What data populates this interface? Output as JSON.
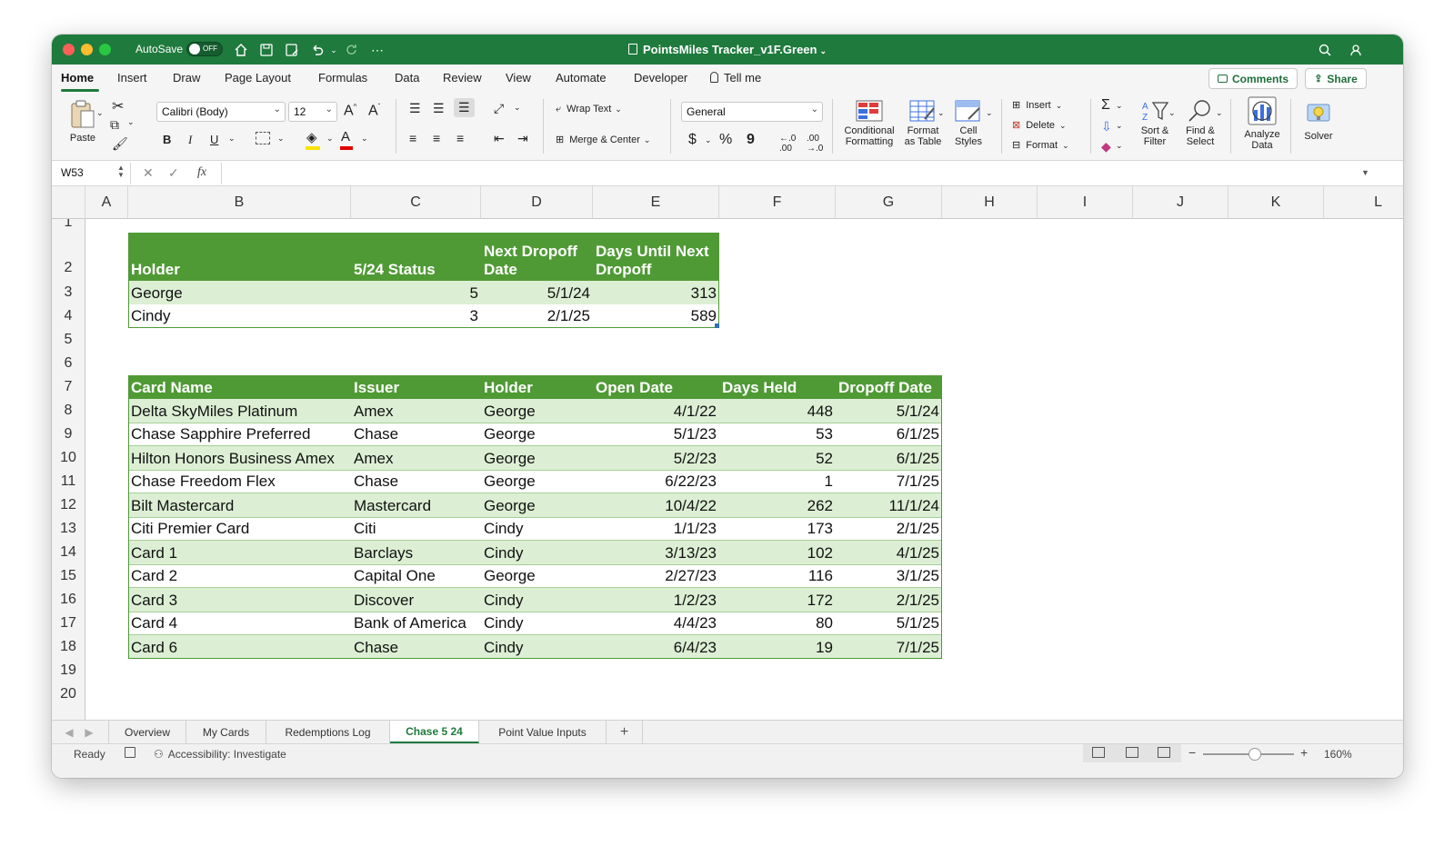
{
  "window": {
    "title": "PointsMiles Tracker_v1F.Green",
    "autosave_label": "AutoSave",
    "autosave_state": "OFF"
  },
  "tabs": [
    "Home",
    "Insert",
    "Draw",
    "Page Layout",
    "Formulas",
    "Data",
    "Review",
    "View",
    "Automate",
    "Developer",
    "Tell me"
  ],
  "actions": {
    "comments": "Comments",
    "share": "Share"
  },
  "ribbon": {
    "paste": "Paste",
    "font_name": "Calibri (Body)",
    "font_size": "12",
    "wrap_text": "Wrap Text",
    "merge_center": "Merge & Center",
    "number_format": "General",
    "conditional": [
      "Conditional",
      "Formatting"
    ],
    "format_table": [
      "Format",
      "as Table"
    ],
    "cell_styles": [
      "Cell",
      "Styles"
    ],
    "insert": "Insert",
    "delete": "Delete",
    "format": "Format",
    "sort_filter": [
      "Sort &",
      "Filter"
    ],
    "find_select": [
      "Find &",
      "Select"
    ],
    "analyze": [
      "Analyze",
      "Data"
    ],
    "solver": "Solver"
  },
  "formula_bar": {
    "name_box": "W53",
    "fx": "fx",
    "content": ""
  },
  "columns": [
    "A",
    "B",
    "C",
    "D",
    "E",
    "F",
    "G",
    "H",
    "I",
    "J",
    "K",
    "L"
  ],
  "rows": [
    "1",
    "2",
    "3",
    "4",
    "5",
    "6",
    "7",
    "8",
    "9",
    "10",
    "11",
    "12",
    "13",
    "14",
    "15",
    "16",
    "17",
    "18",
    "19",
    "20"
  ],
  "table1": {
    "headers": [
      "Holder",
      "5/24 Status",
      "Next Dropoff",
      "Date",
      "Days Until Next",
      "Dropoff"
    ],
    "rows": [
      [
        "George",
        "5",
        "5/1/24",
        "313"
      ],
      [
        "Cindy",
        "3",
        "2/1/25",
        "589"
      ]
    ]
  },
  "table2": {
    "headers": [
      "Card Name",
      "Issuer",
      "Holder",
      "Open Date",
      "Days Held",
      "Dropoff Date"
    ],
    "rows": [
      [
        "Delta SkyMiles Platinum",
        "Amex",
        "George",
        "4/1/22",
        "448",
        "5/1/24"
      ],
      [
        "Chase Sapphire Preferred",
        "Chase",
        "George",
        "5/1/23",
        "53",
        "6/1/25"
      ],
      [
        "Hilton Honors Business Amex",
        "Amex",
        "George",
        "5/2/23",
        "52",
        "6/1/25"
      ],
      [
        "Chase Freedom Flex",
        "Chase",
        "George",
        "6/22/23",
        "1",
        "7/1/25"
      ],
      [
        "Bilt Mastercard",
        "Mastercard",
        "George",
        "10/4/22",
        "262",
        "11/1/24"
      ],
      [
        "Citi Premier Card",
        "Citi",
        "Cindy",
        "1/1/23",
        "173",
        "2/1/25"
      ],
      [
        "Card 1",
        "Barclays",
        "Cindy",
        "3/13/23",
        "102",
        "4/1/25"
      ],
      [
        "Card 2",
        "Capital One",
        "George",
        "2/27/23",
        "116",
        "3/1/25"
      ],
      [
        "Card 3",
        "Discover",
        "Cindy",
        "1/2/23",
        "172",
        "2/1/25"
      ],
      [
        "Card 4",
        "Bank of America",
        "Cindy",
        "4/4/23",
        "80",
        "5/1/25"
      ],
      [
        "Card 6",
        "Chase",
        "Cindy",
        "6/4/23",
        "19",
        "7/1/25"
      ]
    ]
  },
  "sheets": [
    "Overview",
    "My Cards",
    "Redemptions Log",
    "Chase 5 24",
    "Point Value Inputs"
  ],
  "active_sheet": "Chase 5 24",
  "status": {
    "ready": "Ready",
    "accessibility": "Accessibility: Investigate",
    "zoom": "160%"
  },
  "colors": {
    "title_green": "#1f7a3d",
    "header_green": "#4f9a35",
    "band_green": "#dcefd4"
  }
}
